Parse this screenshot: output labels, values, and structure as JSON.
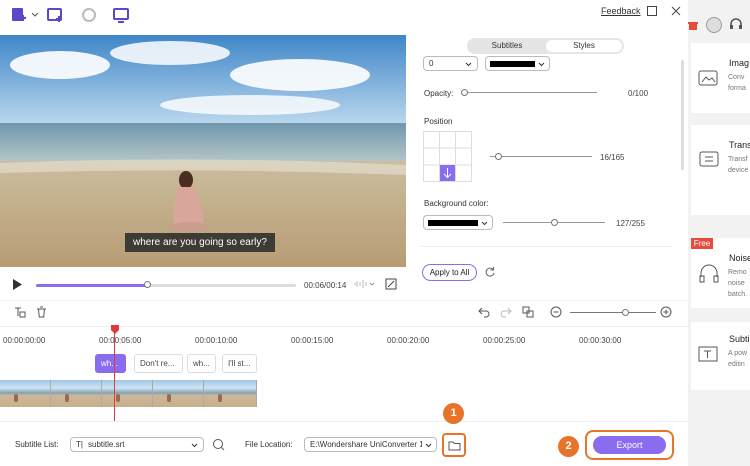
{
  "toolbar": {
    "feedback_label": "Feedback"
  },
  "preview": {
    "caption": "where are you going so early?",
    "time": "00:06/00:14",
    "progress": 0.43
  },
  "panel": {
    "tabs": [
      "Subtitles",
      "Styles"
    ],
    "active_tab": "Styles",
    "size_value": "0",
    "opacity_label": "Opacity:",
    "opacity_value": "0/100",
    "position_label": "Position",
    "position_value": "16/165",
    "bg_label": "Background color:",
    "bg_value": "127/255",
    "apply_all_label": "Apply to All"
  },
  "timeline": {
    "ruler": [
      "00:00:00:00",
      "00:00:05:00",
      "00:00:10:00",
      "00:00:15:00",
      "00:00:20:00",
      "00:00:25:00",
      "00:00:30:00"
    ],
    "clips": [
      "wh...",
      "Don't re...",
      "wh...",
      "I'll st..."
    ]
  },
  "bottom": {
    "subtitle_list_label": "Subtitle List:",
    "subtitle_file": "subtitle.srt",
    "file_location_label": "File Location:",
    "file_location_value": "E:\\Wondershare UniConverter 1",
    "export_label": "Export",
    "callout_1": "1",
    "callout_2": "2"
  },
  "sidebar": {
    "items": [
      {
        "title": "Imag",
        "desc": [
          "Conv",
          "forma"
        ]
      },
      {
        "title": "Trans",
        "desc": [
          "Transf",
          "device"
        ]
      },
      {
        "title": "Noise",
        "desc": [
          "Remo",
          "noise",
          "batch."
        ],
        "badge": "Free"
      },
      {
        "title": "Subti",
        "desc": [
          "A pow",
          "editin"
        ]
      }
    ]
  },
  "colors": {
    "accent": "#8a6cf0",
    "callout": "#e8742a"
  }
}
